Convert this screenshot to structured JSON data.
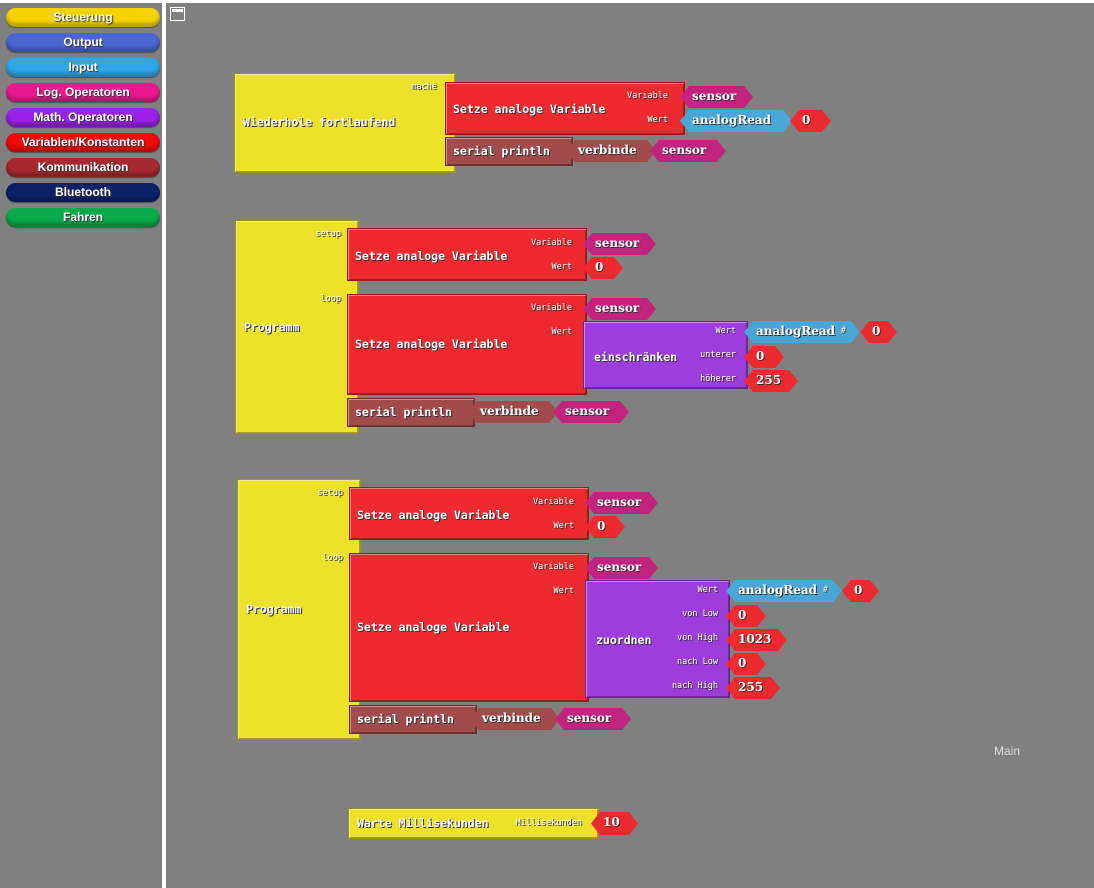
{
  "sidebar": {
    "categories": [
      {
        "label": "Steuerung",
        "color": "#f5d300"
      },
      {
        "label": "Output",
        "color": "#4a66d0"
      },
      {
        "label": "Input",
        "color": "#2ea6e6"
      },
      {
        "label": "Log. Operatoren",
        "color": "#e8198f"
      },
      {
        "label": "Math. Operatoren",
        "color": "#9a22e6"
      },
      {
        "label": "Variablen/Konstanten",
        "color": "#f10a0a"
      },
      {
        "label": "Kommunikation",
        "color": "#a52a30"
      },
      {
        "label": "Bluetooth",
        "color": "#0b2266"
      },
      {
        "label": "Fahren",
        "color": "#0aaa4a"
      }
    ]
  },
  "workspace": {
    "label": "Main"
  },
  "g1": {
    "loop": "Wiederhole fortlaufend",
    "mache": "mache",
    "set": "Setze analoge Variable",
    "variable": "Variable",
    "wert": "Wert",
    "var": "sensor",
    "analogread": "analogRead",
    "hash": "#",
    "pin": "0",
    "println": "serial println",
    "verbinde": "verbinde",
    "var2": "sensor"
  },
  "g2": {
    "program": "Programm",
    "setup": "setup",
    "loop": "loop",
    "set1": "Setze analoge Variable",
    "variable1": "Variable",
    "wert1": "Wert",
    "var1": "sensor",
    "val1": "0",
    "set2": "Setze analoge Variable",
    "variable2": "Variable",
    "wert2": "Wert",
    "var2": "sensor",
    "fn": "einschränken",
    "fwert": "Wert",
    "unterer": "unterer",
    "hoeherer": "höherer",
    "analogread": "analogRead",
    "hash": "#",
    "pin": "0",
    "low": "0",
    "high": "255",
    "println": "serial println",
    "verbinde": "verbinde",
    "var3": "sensor"
  },
  "g3": {
    "program": "Programm",
    "setup": "setup",
    "loop": "loop",
    "set1": "Setze analoge Variable",
    "variable1": "Variable",
    "wert1": "Wert",
    "var1": "sensor",
    "val1": "0",
    "set2": "Setze analoge Variable",
    "variable2": "Variable",
    "wert2": "Wert",
    "var2": "sensor",
    "fn": "zuordnen",
    "fwert": "Wert",
    "vonlow": "von Low",
    "vonhigh": "von High",
    "nachlow": "nach Low",
    "nachhigh": "nach High",
    "analogread": "analogRead",
    "hash": "#",
    "pin": "0",
    "vl": "0",
    "vh": "1023",
    "nl": "0",
    "nh": "255",
    "println": "serial println",
    "verbinde": "verbinde",
    "var3": "sensor"
  },
  "g4": {
    "wait": "Warte Millisekunden",
    "ms_label": "Millisekunden",
    "ms": "10"
  }
}
